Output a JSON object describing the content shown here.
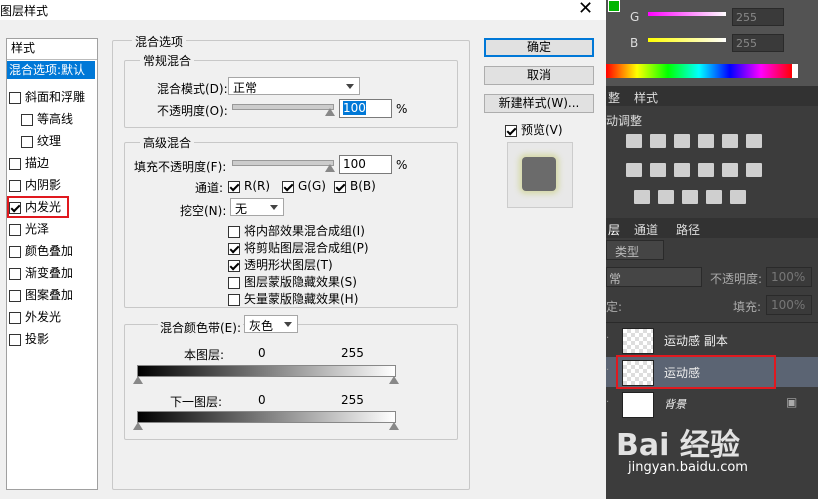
{
  "dialog": {
    "title": "图层样式",
    "close": "✕",
    "styles_header": "样式",
    "styles": [
      {
        "label": "混合选项:默认",
        "checkbox": false,
        "selected": true
      },
      {
        "label": "斜面和浮雕",
        "checkbox": true,
        "checked": false
      },
      {
        "label": "等高线",
        "checkbox": true,
        "checked": false
      },
      {
        "label": "纹理",
        "checkbox": true,
        "checked": false
      },
      {
        "label": "描边",
        "checkbox": true,
        "checked": false
      },
      {
        "label": "内阴影",
        "checkbox": true,
        "checked": false
      },
      {
        "label": "内发光",
        "checkbox": true,
        "checked": true
      },
      {
        "label": "光泽",
        "checkbox": true,
        "checked": false
      },
      {
        "label": "颜色叠加",
        "checkbox": true,
        "checked": false
      },
      {
        "label": "渐变叠加",
        "checkbox": true,
        "checked": false
      },
      {
        "label": "图案叠加",
        "checkbox": true,
        "checked": false
      },
      {
        "label": "外发光",
        "checkbox": true,
        "checked": false
      },
      {
        "label": "投影",
        "checkbox": true,
        "checked": false
      }
    ],
    "blend_options_title": "混合选项",
    "general": {
      "title": "常规混合",
      "mode_label": "混合模式(D):",
      "mode_value": "正常",
      "opacity_label": "不透明度(O):",
      "opacity_value": "100",
      "percent": "%"
    },
    "advanced": {
      "title": "高级混合",
      "fill_label": "填充不透明度(F):",
      "fill_value": "100",
      "percent": "%",
      "channels_label": "通道:",
      "channels": [
        {
          "label": "R(R)",
          "checked": true
        },
        {
          "label": "G(G)",
          "checked": true
        },
        {
          "label": "B(B)",
          "checked": true
        }
      ],
      "knockout_label": "挖空(N):",
      "knockout_value": "无",
      "options": [
        {
          "label": "将内部效果混合成组(I)",
          "checked": false
        },
        {
          "label": "将剪贴图层混合成组(P)",
          "checked": true
        },
        {
          "label": "透明形状图层(T)",
          "checked": true
        },
        {
          "label": "图层蒙版隐藏效果(S)",
          "checked": false
        },
        {
          "label": "矢量蒙版隐藏效果(H)",
          "checked": false
        }
      ]
    },
    "blend_if": {
      "label": "混合颜色带(E):",
      "value": "灰色",
      "this_layer": "本图层:",
      "underlying": "下一图层:",
      "min": "0",
      "max": "255"
    },
    "buttons": {
      "ok": "确定",
      "cancel": "取消",
      "new_style": "新建样式(W)...",
      "preview": "预览(V)"
    }
  },
  "photoshop": {
    "color": {
      "g_label": "G",
      "b_label": "B",
      "g_value": "255",
      "b_value": "255"
    },
    "adjust_tabs": [
      "整",
      "样式"
    ],
    "adjust_title": "动调整",
    "layers_tabs": [
      "层",
      "通道",
      "路径"
    ],
    "filter_type": "类型",
    "blend_mode": "常",
    "opacity_label": "不透明度:",
    "opacity_value": "100%",
    "lock_label": "定:",
    "fill_label": "填充:",
    "fill_value": "100%",
    "layers": [
      {
        "name": "运动感 副本",
        "selected": false
      },
      {
        "name": "运动感",
        "selected": true
      },
      {
        "name": "背景",
        "selected": false
      }
    ]
  },
  "watermark": {
    "brand": "Bai 经验",
    "url": "jingyan.baidu.com"
  },
  "colors": {
    "accent": "#0078d7",
    "highlight": "#e0191f",
    "ps_bg": "#3c3c3c"
  }
}
